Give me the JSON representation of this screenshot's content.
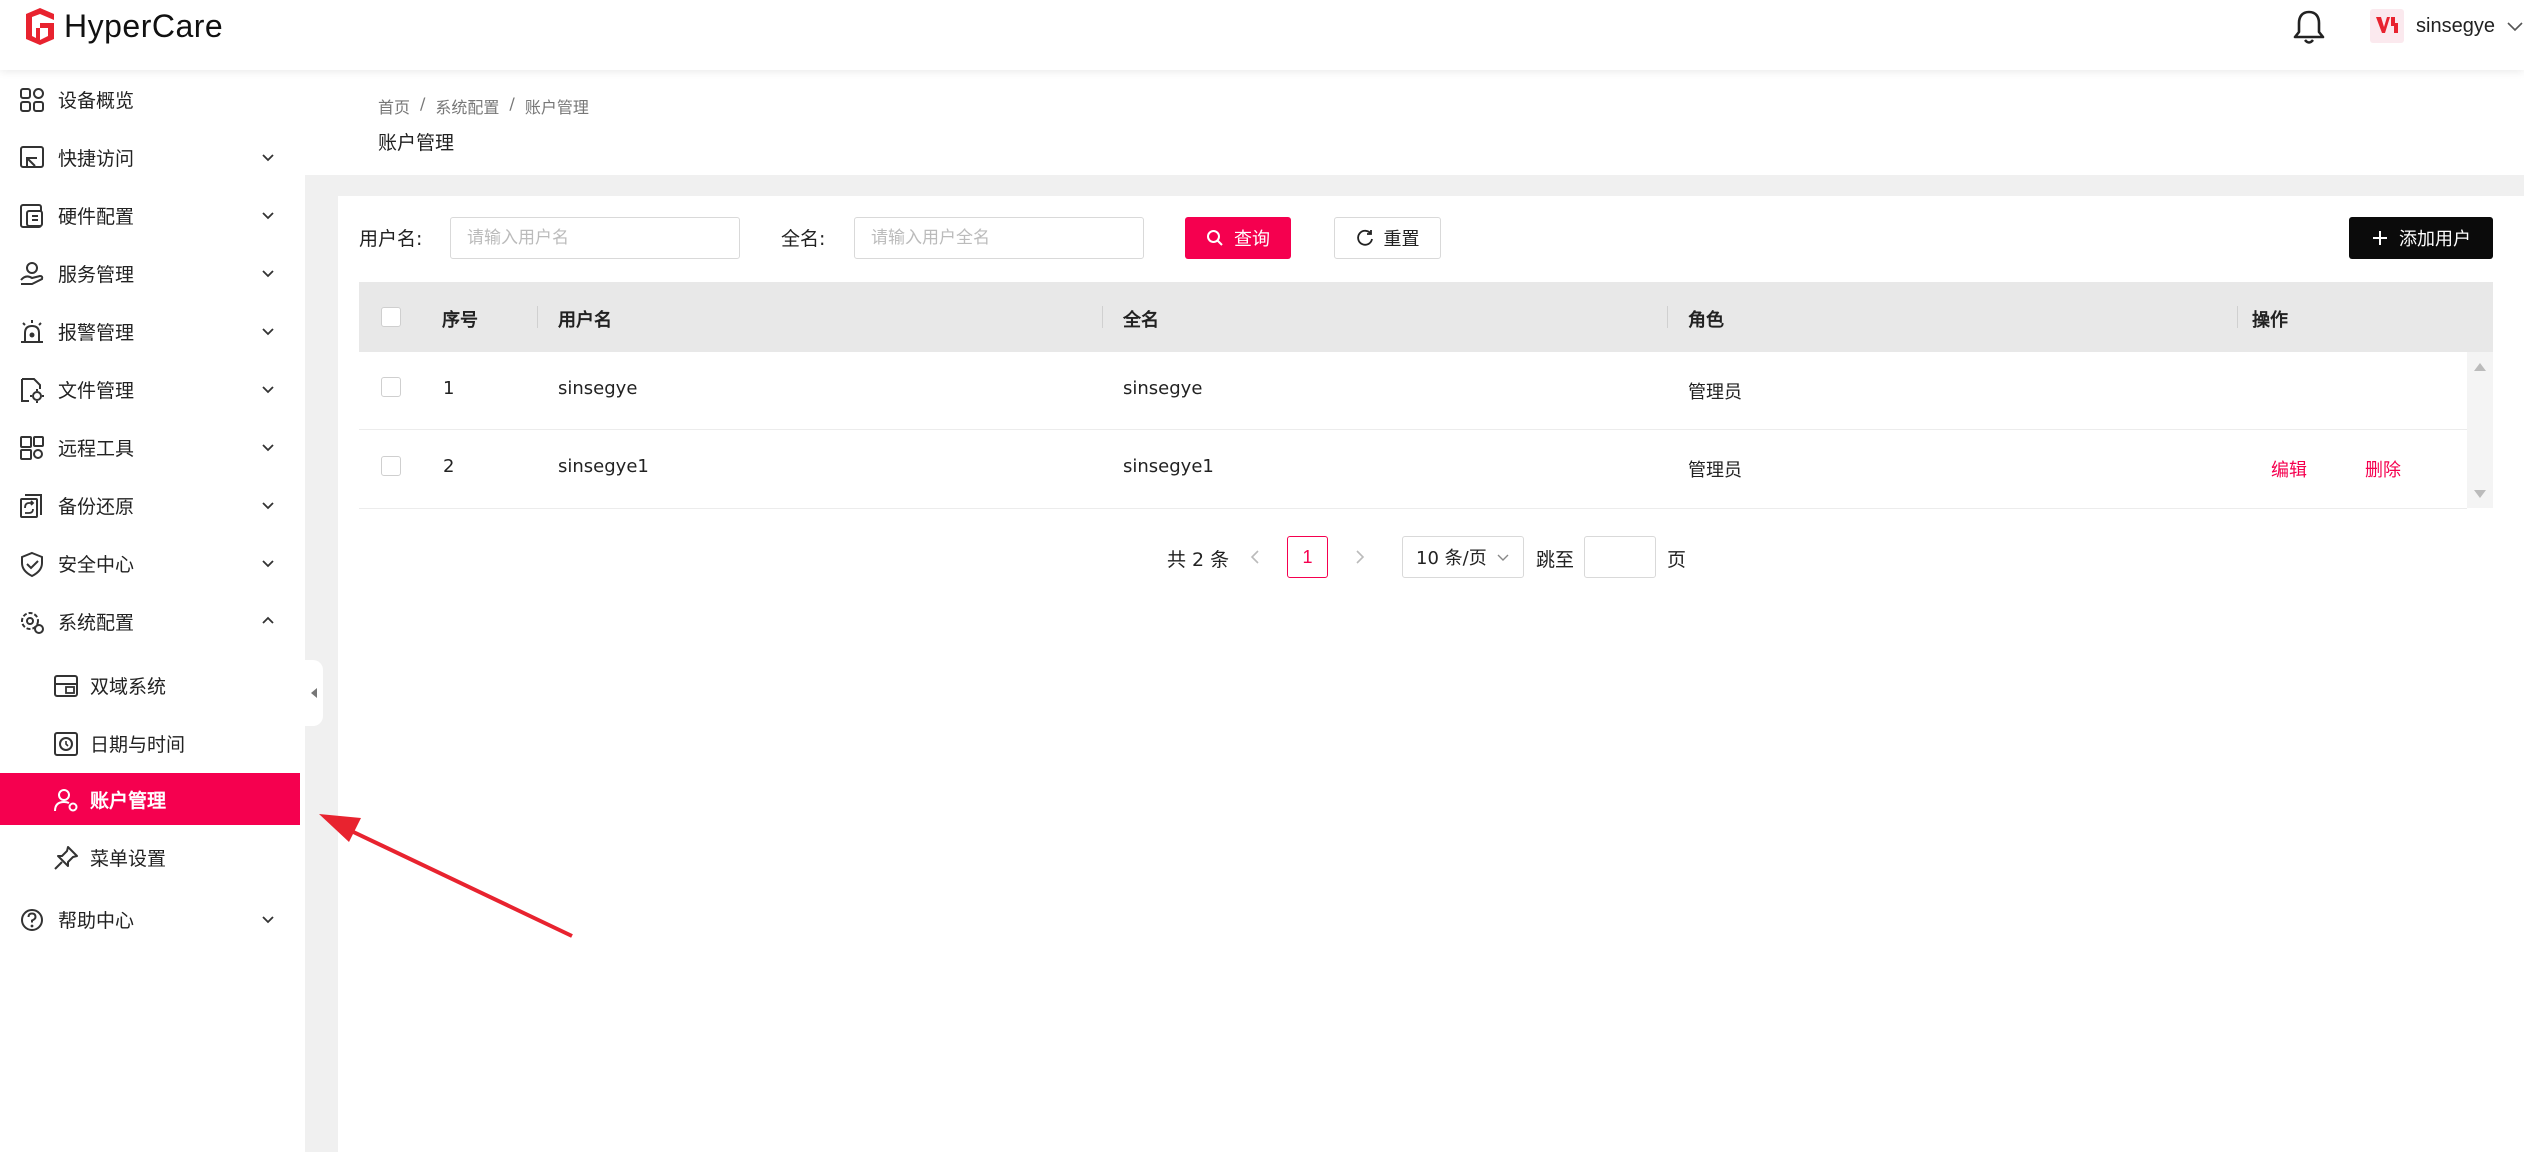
{
  "app": {
    "brand": "HyperCare",
    "user_name": "sinsegye"
  },
  "sidebar": {
    "items": [
      {
        "label": "设备概览",
        "icon": "grid-icon"
      },
      {
        "label": "快捷访问",
        "icon": "shortcut-icon"
      },
      {
        "label": "硬件配置",
        "icon": "hardware-icon"
      },
      {
        "label": "服务管理",
        "icon": "service-icon"
      },
      {
        "label": "报警管理",
        "icon": "alarm-icon"
      },
      {
        "label": "文件管理",
        "icon": "file-gear-icon"
      },
      {
        "label": "远程工具",
        "icon": "remote-tool-icon"
      },
      {
        "label": "备份还原",
        "icon": "backup-icon"
      },
      {
        "label": "安全中心",
        "icon": "shield-icon"
      },
      {
        "label": "系统配置",
        "icon": "system-config-icon"
      },
      {
        "label": "帮助中心",
        "icon": "help-icon"
      }
    ],
    "sub_items": [
      {
        "label": "双域系统",
        "icon": "dual-domain-icon"
      },
      {
        "label": "日期与时间",
        "icon": "clock-icon"
      },
      {
        "label": "账户管理",
        "icon": "user-gear-icon",
        "active": true
      },
      {
        "label": "菜单设置",
        "icon": "pin-icon"
      }
    ]
  },
  "header": {
    "breadcrumb": [
      "首页",
      "系统配置",
      "账户管理"
    ],
    "breadcrumb_sep": "/",
    "title": "账户管理"
  },
  "filters": {
    "username_label": "用户名:",
    "username_placeholder": "请输入用户名",
    "fullname_label": "全名:",
    "fullname_placeholder": "请输入用户全名",
    "query_label": "查询",
    "reset_label": "重置",
    "add_label": "添加用户"
  },
  "table": {
    "columns": [
      "序号",
      "用户名",
      "全名",
      "角色",
      "操作"
    ],
    "rows": [
      {
        "index": "1",
        "username": "sinsegye",
        "fullname": "sinsegye",
        "role": "管理员",
        "actions": []
      },
      {
        "index": "2",
        "username": "sinsegye1",
        "fullname": "sinsegye1",
        "role": "管理员",
        "actions": [
          "编辑",
          "删除"
        ]
      }
    ]
  },
  "pagination": {
    "total_text": "共 2 条",
    "current_page": "1",
    "page_size": "10 条/页",
    "jump_label": "跳至",
    "page_unit": "页"
  },
  "colors": {
    "accent": "#f5004f",
    "annotation": "#e8232f"
  }
}
